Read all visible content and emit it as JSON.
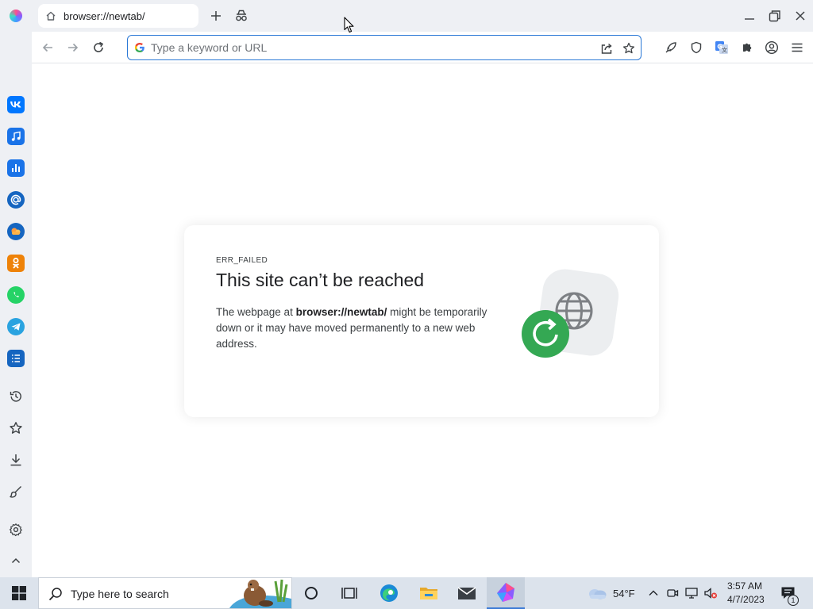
{
  "window": {
    "tab_title": "browser://newtab/",
    "icons": [
      "app-logo",
      "home-icon",
      "new-tab-icon",
      "incognito-icon",
      "minimize-icon",
      "restore-icon",
      "close-icon"
    ]
  },
  "toolbar": {
    "omnibox_placeholder": "Type a keyword or URL",
    "omnibox_value": "",
    "icons": [
      "back-icon",
      "forward-icon",
      "reload-icon",
      "google-icon",
      "share-icon",
      "bookmark-star-icon",
      "rocket-icon",
      "shield-icon",
      "translate-icon",
      "extensions-icon",
      "profile-icon",
      "menu-icon"
    ]
  },
  "sidebar": {
    "apps": [
      {
        "name": "vk",
        "glyph": "VK",
        "color": "#0077ff"
      },
      {
        "name": "music",
        "glyph": "♫",
        "color": "#1a73e8"
      },
      {
        "name": "stats",
        "glyph": "",
        "color": "#1a73e8"
      },
      {
        "name": "mail",
        "glyph": "@",
        "color": "#1565c0"
      },
      {
        "name": "cloud",
        "glyph": "",
        "color": "#1565c0"
      },
      {
        "name": "ok",
        "glyph": "",
        "color": "#ee8208"
      },
      {
        "name": "whatsapp",
        "glyph": "",
        "color": "#25d366"
      },
      {
        "name": "telegram",
        "glyph": "",
        "color": "#2aa3e0"
      },
      {
        "name": "tasks",
        "glyph": "",
        "color": "#1565c0"
      }
    ],
    "tools": [
      "history-icon",
      "star-icon",
      "download-icon",
      "brush-icon",
      "settings-icon",
      "collapse-icon"
    ]
  },
  "error": {
    "code": "ERR_FAILED",
    "title": "This site can’t be reached",
    "desc_before": "The webpage at ",
    "desc_url": "browser://newtab/",
    "desc_after": " might be temporarily down or it may have moved permanently to a new web address."
  },
  "taskbar": {
    "search_placeholder": "Type here to search",
    "weather_temp": "54°F",
    "clock_time": "3:57 AM",
    "clock_date": "4/7/2023",
    "notification_count": "1",
    "pinned": [
      "cortana-icon",
      "task-view-icon",
      "edge-icon",
      "file-explorer-icon",
      "mail-icon",
      "browser-icon"
    ]
  },
  "colors": {
    "accent": "#2a78d6",
    "chrome_bg": "#eef0f4",
    "reload_green": "#34a853",
    "taskbar_bg": "#dce3ec"
  }
}
